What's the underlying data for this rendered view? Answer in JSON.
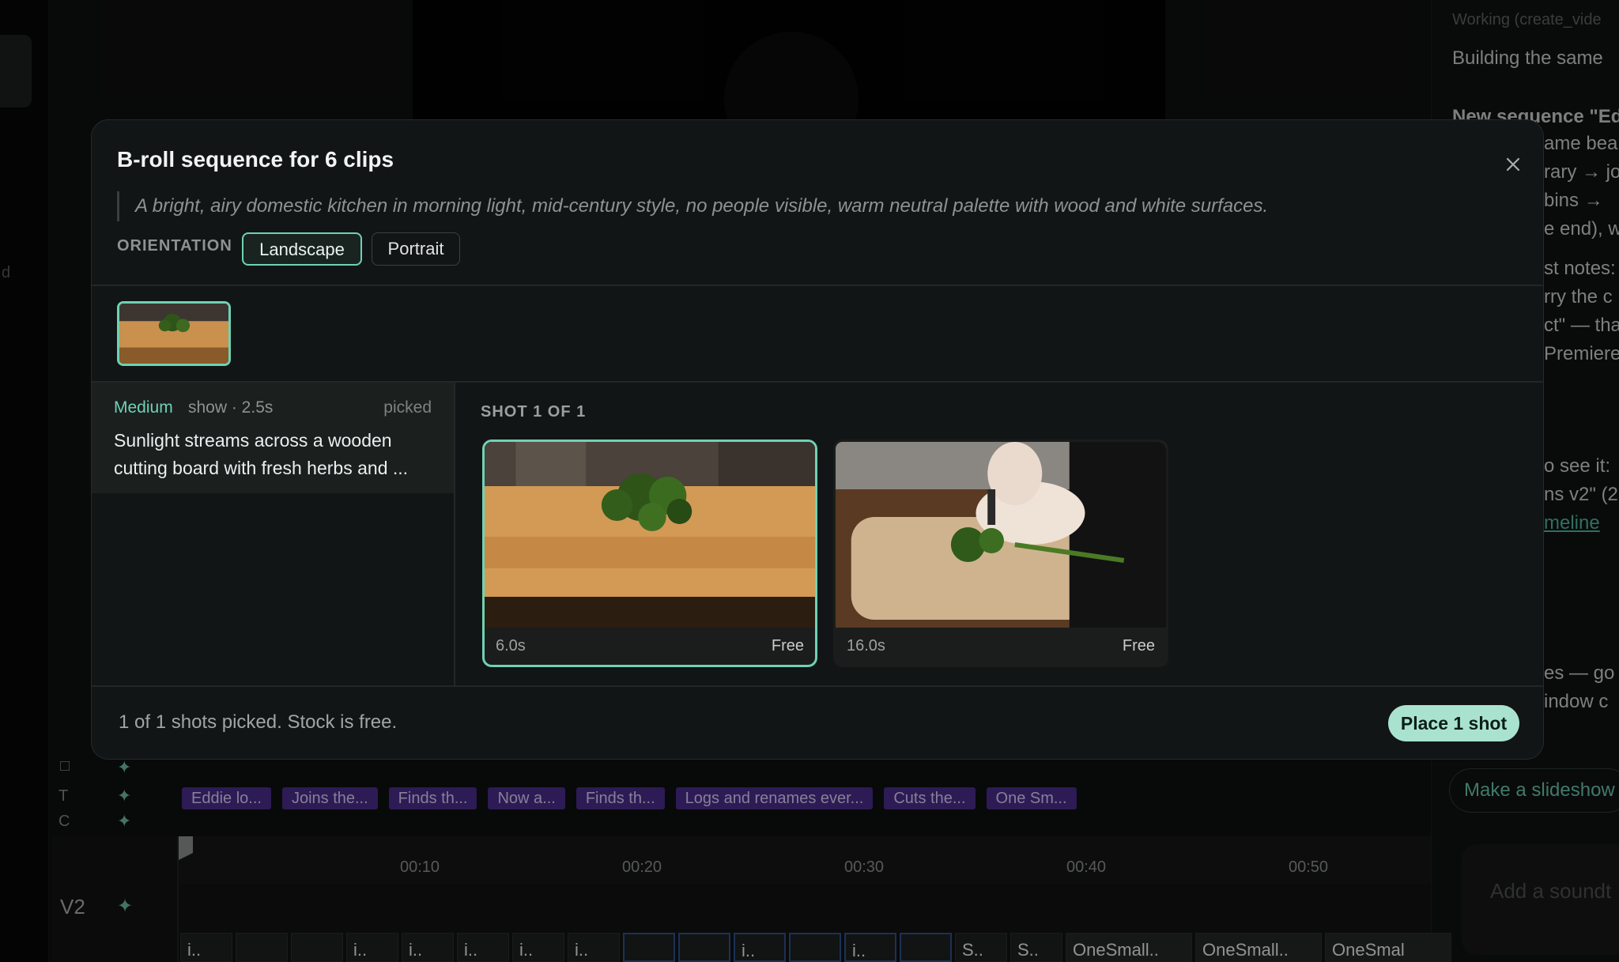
{
  "background": {
    "left_rail_letter": "d",
    "right_panel": {
      "lines": [
        "Working (create_vide",
        "Building the same",
        "New sequence \"Ed",
        "ame bea",
        "rary → jo",
        "bins →",
        "e end), w",
        "st notes:",
        "rry the c",
        "ct\" — tha",
        "Premiere",
        "o see it:",
        "ns v2\" (2",
        "meline",
        "es — go",
        "indow c"
      ],
      "slideshow_button": "Make a slideshow",
      "soundtrack_placeholder": "Add a soundt"
    },
    "track_labels": {
      "t": "T",
      "c": "C",
      "v2": "V2"
    },
    "caption_chips": [
      "Eddie lo...",
      "Joins the...",
      "Finds th...",
      "Now a...",
      "Finds th...",
      "Logs and renames ever...",
      "Cuts the...",
      "One Sm..."
    ],
    "timeline_ticks": [
      "00:10",
      "00:20",
      "00:30",
      "00:40",
      "00:50"
    ],
    "clips": [
      "i..",
      "",
      "",
      "i..",
      "i..",
      "i..",
      "i..",
      "i..",
      "",
      "",
      "i..",
      "",
      "i..",
      "",
      "S..",
      "S..",
      "OneSmall..",
      "OneSmall..",
      "OneSmal"
    ]
  },
  "modal": {
    "title": "B-roll sequence for 6 clips",
    "prompt": "A bright, airy domestic kitchen in morning light, mid-century style, no people visible, warm neutral palette with wood and white surfaces.",
    "orientation_label": "ORIENTATION",
    "orientation_options": [
      "Landscape",
      "Portrait"
    ],
    "orientation_selected": "Landscape",
    "shot": {
      "type": "Medium",
      "meta": "show · 2.5s",
      "status": "picked",
      "description": "Sunlight streams across a wooden cutting board with fresh herbs and ..."
    },
    "shot_heading": "SHOT 1 OF 1",
    "candidates": [
      {
        "duration": "6.0s",
        "price": "Free",
        "selected": true
      },
      {
        "duration": "16.0s",
        "price": "Free",
        "selected": false
      }
    ],
    "footer_text": "1 of 1 shots picked. Stock is free.",
    "place_button": "Place 1 shot"
  },
  "colors": {
    "accent": "#6fd2b4",
    "place_button": "#a9e3d0",
    "caption_chip": "#4a2d8a"
  }
}
